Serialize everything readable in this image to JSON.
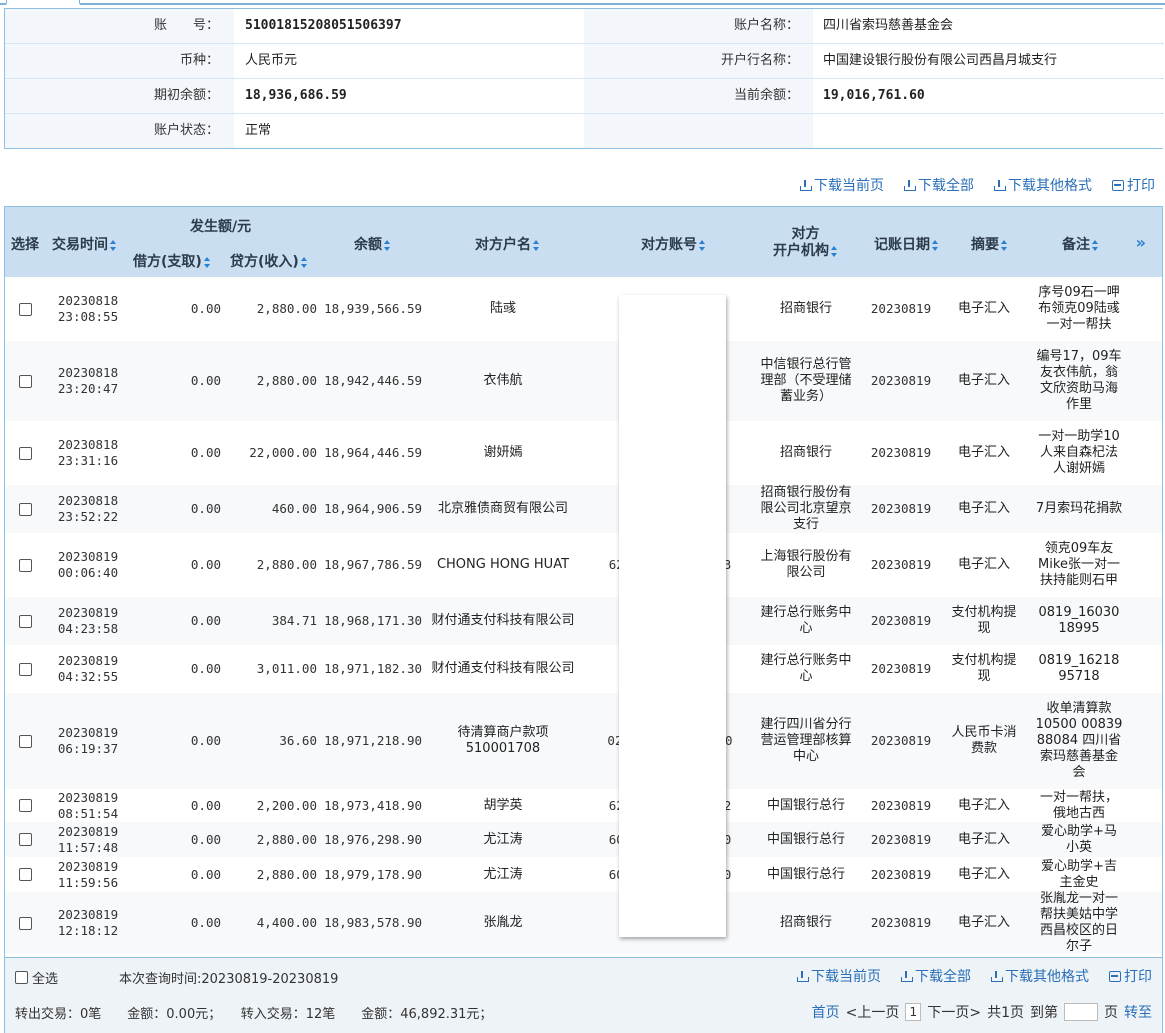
{
  "account": {
    "account_no_label": "账　　号：",
    "account_no": "51001815208051506397",
    "account_name_label": "账户名称：",
    "account_name": "四川省索玛慈善基金会",
    "currency_label": "币种：",
    "currency": "人民币元",
    "bank_label": "开户行名称：",
    "bank": "中国建设银行股份有限公司西昌月城支行",
    "opening_balance_label": "期初余额：",
    "opening_balance": "18,936,686.59",
    "current_balance_label": "当前余额：",
    "current_balance": "19,016,761.60",
    "status_label": "账户状态：",
    "status": "正常"
  },
  "toolbar": {
    "download_current": "下载当前页",
    "download_all": "下载全部",
    "download_other": "下载其他格式",
    "print": "打印"
  },
  "table": {
    "headers": {
      "select": "选择",
      "time": "交易时间",
      "amount_group": "发生额/元",
      "debit": "借方(支取)",
      "credit": "贷方(收入)",
      "balance": "余额",
      "counterparty_name": "对方户名",
      "counterparty_account": "对方账号",
      "counterparty_bank_line1": "对方",
      "counterparty_bank_line2": "开户机构",
      "post_date": "记账日期",
      "summary": "摘要",
      "remark": "备注"
    },
    "more_columns": "»",
    "rows": [
      {
        "date": "20230818",
        "time": "23:08:55",
        "debit": "0.00",
        "credit": "2,880.00",
        "balance": "18,939,566.59",
        "name": "陆彧",
        "acct": "6",
        "bank": "招商银行",
        "post": "20230819",
        "summary": "电子汇入",
        "remark": "序号09石一呷布领克09陆彧一对一帮扶"
      },
      {
        "date": "20230818",
        "time": "23:20:47",
        "debit": "0.00",
        "credit": "2,880.00",
        "balance": "18,942,446.59",
        "name": "衣伟航",
        "acct": "6",
        "bank": "中信银行总行管理部（不受理储蓄业务）",
        "post": "20230819",
        "summary": "电子汇入",
        "remark": "编号17，09车友衣伟航，翁文欣资助马海作里"
      },
      {
        "date": "20230818",
        "time": "23:31:16",
        "debit": "0.00",
        "credit": "22,000.00",
        "balance": "18,964,446.59",
        "name": "谢妍嫣",
        "acct": "6",
        "bank": "招商银行",
        "post": "20230819",
        "summary": "电子汇入",
        "remark": "一对一助学10人来自森杞法人谢妍嫣"
      },
      {
        "date": "20230818",
        "time": "23:52:22",
        "debit": "0.00",
        "credit": "460.00",
        "balance": "18,964,906.59",
        "name": "北京雅债商贸有限公司",
        "acct": "1",
        "bank": "招商银行股份有限公司北京望京支行",
        "post": "20230819",
        "summary": "电子汇入",
        "remark": "7月索玛花捐款"
      },
      {
        "date": "20230819",
        "time": "00:06:40",
        "debit": "0.00",
        "credit": "2,880.00",
        "balance": "18,967,786.59",
        "name": "CHONG HONG HUAT",
        "acct": "62　　　　　　　　3",
        "bank": "上海银行股份有限公司",
        "post": "20230819",
        "summary": "电子汇入",
        "remark": "领克09车友Mike张一对一扶持能则石甲"
      },
      {
        "date": "20230819",
        "time": "04:23:58",
        "debit": "0.00",
        "credit": "384.71",
        "balance": "18,968,171.30",
        "name": "财付通支付科技有限公司",
        "acct": "",
        "bank": "建行总行账务中心",
        "post": "20230819",
        "summary": "支付机构提现",
        "remark": "0819_16030 18995"
      },
      {
        "date": "20230819",
        "time": "04:32:55",
        "debit": "0.00",
        "credit": "3,011.00",
        "balance": "18,971,182.30",
        "name": "财付通支付科技有限公司",
        "acct": "",
        "bank": "建行总行账务中心",
        "post": "20230819",
        "summary": "支付机构提现",
        "remark": "0819_16218 95718"
      },
      {
        "date": "20230819",
        "time": "06:19:37",
        "debit": "0.00",
        "credit": "36.60",
        "balance": "18,971,218.90",
        "name": "待清算商户款项510001708",
        "acct": "02　　　　　　　000",
        "bank": "建行四川省分行营运管理部核算中心",
        "post": "20230819",
        "summary": "人民币卡消费款",
        "remark": "收单清算款 10500 00839 88084 四川省索玛慈善基金会"
      },
      {
        "date": "20230819",
        "time": "08:51:54",
        "debit": "0.00",
        "credit": "2,200.00",
        "balance": "18,973,418.90",
        "name": "胡学英",
        "acct": "62　　　　　　　　2",
        "bank": "中国银行总行",
        "post": "20230819",
        "summary": "电子汇入",
        "remark": "一对一帮扶，俄地古西"
      },
      {
        "date": "20230819",
        "time": "11:57:48",
        "debit": "0.00",
        "credit": "2,880.00",
        "balance": "18,976,298.90",
        "name": "尤江涛",
        "acct": "60　　　　　　　　0",
        "bank": "中国银行总行",
        "post": "20230819",
        "summary": "电子汇入",
        "remark": "爱心助学+马小英"
      },
      {
        "date": "20230819",
        "time": "11:59:56",
        "debit": "0.00",
        "credit": "2,880.00",
        "balance": "18,979,178.90",
        "name": "尤江涛",
        "acct": "60　　　　　　　　0",
        "bank": "中国银行总行",
        "post": "20230819",
        "summary": "电子汇入",
        "remark": "爱心助学+吉主金史"
      },
      {
        "date": "20230819",
        "time": "12:18:12",
        "debit": "0.00",
        "credit": "4,400.00",
        "balance": "18,983,578.90",
        "name": "张胤龙",
        "acct": "6",
        "bank": "招商银行",
        "post": "20230819",
        "summary": "电子汇入",
        "remark": "张胤龙一对一帮扶美姑中学西昌校区的日尔子"
      }
    ]
  },
  "footer": {
    "select_all": "全选",
    "query_time": "本次查询时间:20230819-20230819",
    "out_summary": "转出交易：0笔　　金额：0.00元；　　转入交易：12笔　　金额：46,892.31元；",
    "first": "首页",
    "prev": "<上一页",
    "current_page": "1",
    "next": "下一页>",
    "total_pages": "共1页",
    "goto_label": "到第",
    "page_unit": "页",
    "go": "转至"
  }
}
